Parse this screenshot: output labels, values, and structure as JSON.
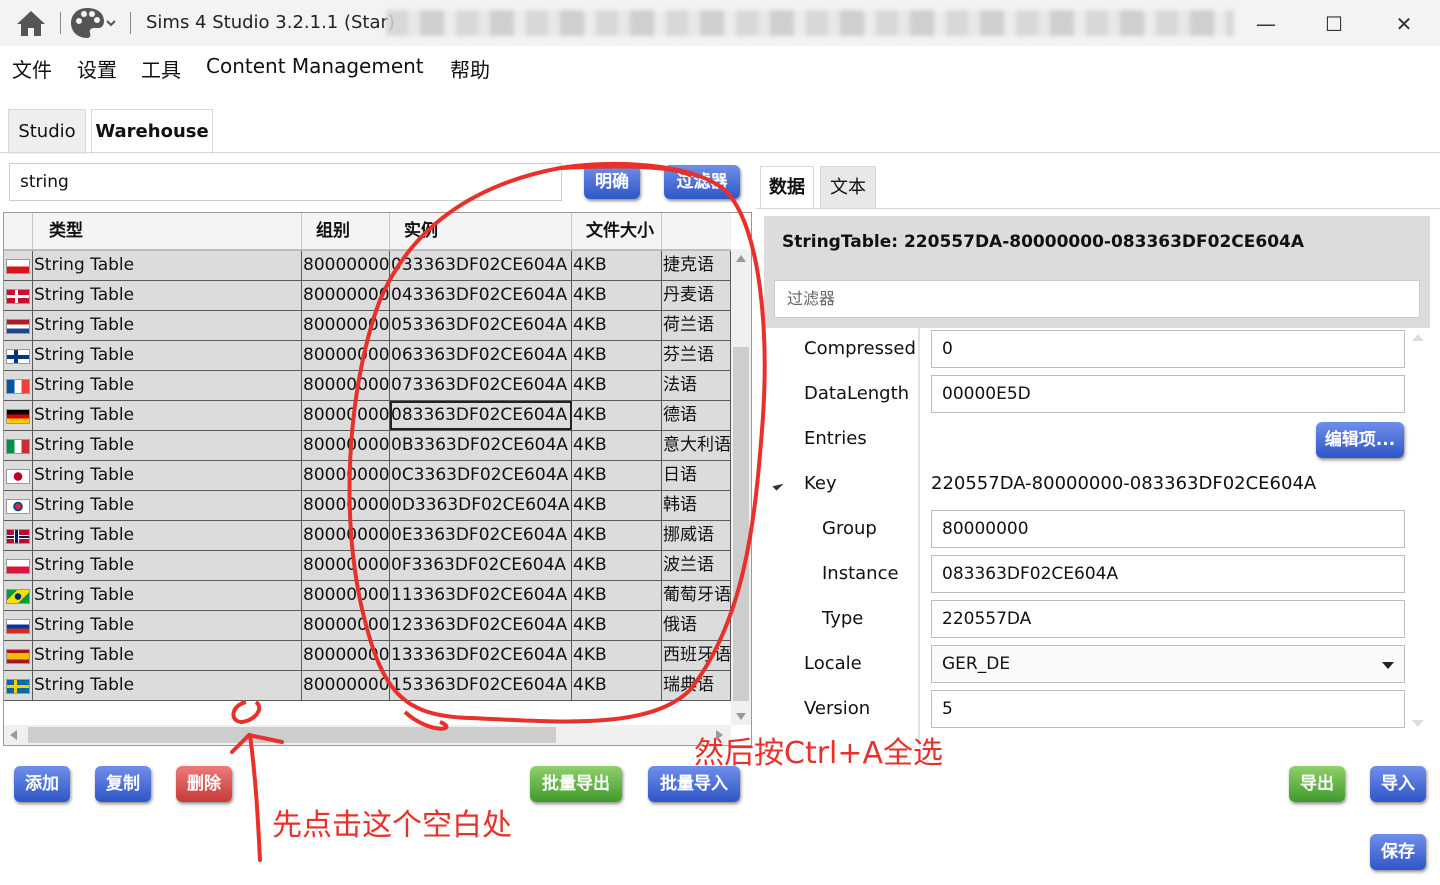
{
  "window": {
    "title": "Sims 4 Studio 3.2.1.1 (Star)",
    "min_label": "—",
    "max_label": "☐",
    "close_label": "✕"
  },
  "menu": {
    "items": [
      "文件",
      "设置",
      "工具",
      "Content Management",
      "帮助"
    ]
  },
  "main_tabs": [
    "Studio",
    "Warehouse"
  ],
  "search": {
    "value": "string",
    "clear_label": "明确",
    "filter_label": "过滤器"
  },
  "grid": {
    "columns": [
      "类型",
      "组别",
      "实例",
      "文件大小"
    ],
    "rows": [
      {
        "flag": "cz",
        "type": "String Table",
        "group": "80000000",
        "instance": "033363DF02CE604A",
        "size": "4KB",
        "lang": "捷克语"
      },
      {
        "flag": "dk",
        "type": "String Table",
        "group": "80000000",
        "instance": "043363DF02CE604A",
        "size": "4KB",
        "lang": "丹麦语"
      },
      {
        "flag": "nl",
        "type": "String Table",
        "group": "80000000",
        "instance": "053363DF02CE604A",
        "size": "4KB",
        "lang": "荷兰语"
      },
      {
        "flag": "fi",
        "type": "String Table",
        "group": "80000000",
        "instance": "063363DF02CE604A",
        "size": "4KB",
        "lang": "芬兰语"
      },
      {
        "flag": "fr",
        "type": "String Table",
        "group": "80000000",
        "instance": "073363DF02CE604A",
        "size": "4KB",
        "lang": "法语"
      },
      {
        "flag": "de",
        "type": "String Table",
        "group": "80000000",
        "instance": "083363DF02CE604A",
        "size": "4KB",
        "lang": "德语"
      },
      {
        "flag": "it",
        "type": "String Table",
        "group": "80000000",
        "instance": "0B3363DF02CE604A",
        "size": "4KB",
        "lang": "意大利语"
      },
      {
        "flag": "jp",
        "type": "String Table",
        "group": "80000000",
        "instance": "0C3363DF02CE604A",
        "size": "4KB",
        "lang": "日语"
      },
      {
        "flag": "kr",
        "type": "String Table",
        "group": "80000000",
        "instance": "0D3363DF02CE604A",
        "size": "4KB",
        "lang": "韩语"
      },
      {
        "flag": "no",
        "type": "String Table",
        "group": "80000000",
        "instance": "0E3363DF02CE604A",
        "size": "4KB",
        "lang": "挪威语"
      },
      {
        "flag": "pl",
        "type": "String Table",
        "group": "80000000",
        "instance": "0F3363DF02CE604A",
        "size": "4KB",
        "lang": "波兰语"
      },
      {
        "flag": "br",
        "type": "String Table",
        "group": "80000000",
        "instance": "113363DF02CE604A",
        "size": "4KB",
        "lang": "葡萄牙语"
      },
      {
        "flag": "ru",
        "type": "String Table",
        "group": "80000000",
        "instance": "123363DF02CE604A",
        "size": "4KB",
        "lang": "俄语"
      },
      {
        "flag": "es",
        "type": "String Table",
        "group": "80000000",
        "instance": "133363DF02CE604A",
        "size": "4KB",
        "lang": "西班牙语"
      },
      {
        "flag": "se",
        "type": "String Table",
        "group": "80000000",
        "instance": "153363DF02CE604A",
        "size": "4KB",
        "lang": "瑞典语"
      }
    ]
  },
  "buttons": {
    "add": "添加",
    "copy": "复制",
    "delete": "删除",
    "batch_export": "批量导出",
    "batch_import": "批量导入",
    "export": "导出",
    "import": "导入",
    "save": "保存",
    "edit_items": "编辑项..."
  },
  "right_tabs": [
    "数据",
    "文本"
  ],
  "detail": {
    "title": "StringTable: 220557DA-80000000-083363DF02CE604A",
    "filter_placeholder": "过滤器",
    "labels": {
      "compressed": "Compressed",
      "data_length": "DataLength",
      "entries": "Entries",
      "key": "Key",
      "group": "Group",
      "instance": "Instance",
      "type": "Type",
      "locale": "Locale",
      "version": "Version"
    },
    "values": {
      "compressed": "0",
      "data_length": "00000E5D",
      "key": "220557DA-80000000-083363DF02CE604A",
      "group": "80000000",
      "instance": "083363DF02CE604A",
      "type": "220557DA",
      "locale": "GER_DE",
      "version": "5"
    }
  },
  "annotations": {
    "click_blank": "先点击这个空白处",
    "select_all": "然后按Ctrl+A全选"
  },
  "colors": {
    "annotation_red": "#e8312a",
    "button_blue": "#2f56c8",
    "button_green": "#3f9a2c",
    "button_red": "#c63a3a",
    "row_bg": "#dcdcdc"
  }
}
